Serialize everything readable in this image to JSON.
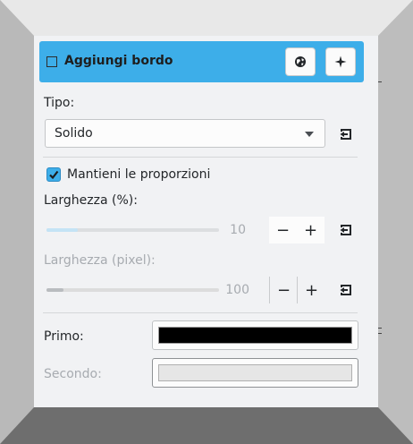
{
  "colors": {
    "accent": "#3daee9",
    "frame_top": "#e6e6e6",
    "frame_bottom": "#6a6a6a",
    "panel": "#f1f2f4",
    "primary_color": "#000000",
    "secondary_color": "#e6e6e6"
  },
  "header": {
    "title": "Aggiungi bordo",
    "enabled": false,
    "globe_icon": "globe-icon",
    "star_icon": "sparkle-icon"
  },
  "type": {
    "label": "Tipo:",
    "value": "Solido"
  },
  "keep_ratio": {
    "label": "Mantieni le proporzioni",
    "checked": true
  },
  "width_percent": {
    "label": "Larghezza (%):",
    "value": "10",
    "fraction": 0.1,
    "minus": "−",
    "plus": "+"
  },
  "width_pixel": {
    "label": "Larghezza (pixel):",
    "value": "100",
    "fraction": 0.1,
    "minus": "−",
    "plus": "+"
  },
  "primary": {
    "label": "Primo:"
  },
  "secondary": {
    "label": "Secondo:"
  }
}
